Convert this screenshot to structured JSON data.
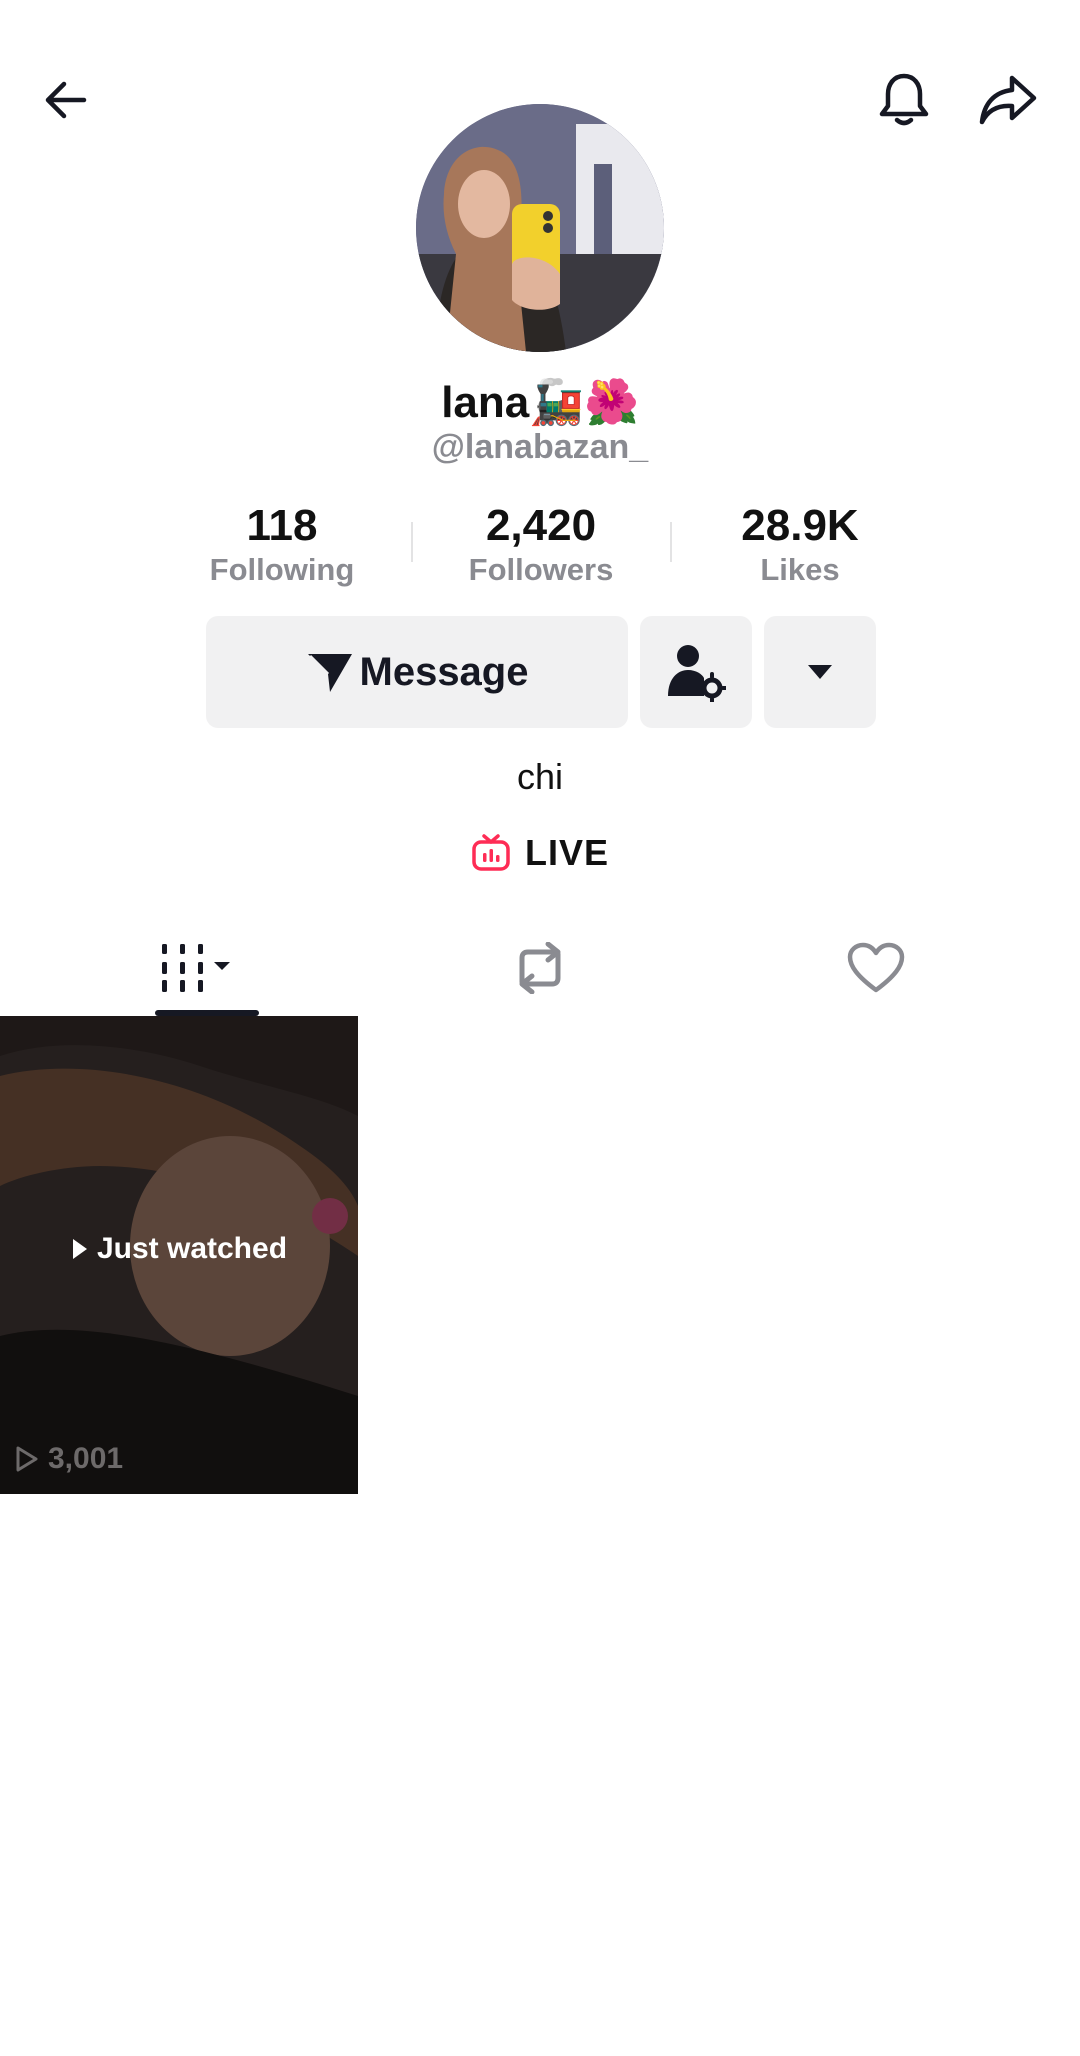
{
  "header": {
    "back_icon": "arrow-left-icon",
    "bell_icon": "bell-icon",
    "share_icon": "share-arrow-icon"
  },
  "profile": {
    "display_name": "lana🚂🌺",
    "username": "@lanabazan_",
    "bio": "chi"
  },
  "stats": [
    {
      "value": "118",
      "label": "Following"
    },
    {
      "value": "2,420",
      "label": "Followers"
    },
    {
      "value": "28.9K",
      "label": "Likes"
    }
  ],
  "actions": {
    "message_label": "Message",
    "message_icon": "send-icon",
    "friends_icon": "person-settings-icon",
    "more_icon": "caret-down-icon"
  },
  "live": {
    "label": "LIVE",
    "icon": "live-tv-icon",
    "accent": "#fe2c55"
  },
  "tabs": [
    {
      "name": "videos",
      "icon": "grid-icon",
      "selected": true
    },
    {
      "name": "reposts",
      "icon": "repost-icon",
      "selected": false
    },
    {
      "name": "liked",
      "icon": "heart-outline-icon",
      "selected": false
    }
  ],
  "videos": [
    {
      "badge": "Just watched",
      "views": "3,001"
    }
  ]
}
